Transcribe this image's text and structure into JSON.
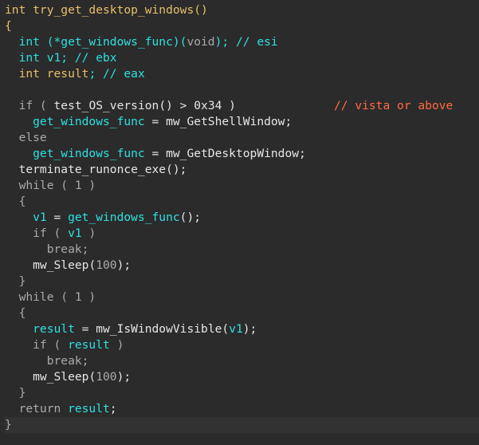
{
  "code_lines": [
    [
      {
        "t": "int try_get_desktop_windows()",
        "c": "t-name"
      }
    ],
    [
      {
        "t": "{",
        "c": "t-name"
      }
    ],
    [
      {
        "t": "  int ",
        "c": "t-cyan"
      },
      {
        "t": "(*get_windows_func)(",
        "c": "t-cyan"
      },
      {
        "t": "void",
        "c": "t-dim"
      },
      {
        "t": "); // esi",
        "c": "t-cyan"
      }
    ],
    [
      {
        "t": "  int ",
        "c": "t-cyan"
      },
      {
        "t": "v1",
        "c": "t-cyan"
      },
      {
        "t": "; // ebx",
        "c": "t-cyan"
      }
    ],
    [
      {
        "t": "  int ",
        "c": "t-name"
      },
      {
        "t": "result",
        "c": "t-name"
      },
      {
        "t": "; // eax",
        "c": "t-cyan"
      }
    ],
    [
      {
        "t": "",
        "c": "t-plain"
      }
    ],
    [
      {
        "t": "  if ( ",
        "c": "t-dim"
      },
      {
        "t": "test_OS_version",
        "c": "t-white"
      },
      {
        "t": "() > 0x34 )              ",
        "c": "t-white"
      },
      {
        "t": "// vista or above",
        "c": "t-cmt-red"
      }
    ],
    [
      {
        "t": "    get_windows_func",
        "c": "t-cyan"
      },
      {
        "t": " = ",
        "c": "t-white"
      },
      {
        "t": "mw_GetShellWindow",
        "c": "t-white"
      },
      {
        "t": ";",
        "c": "t-white"
      }
    ],
    [
      {
        "t": "  else",
        "c": "t-dim"
      }
    ],
    [
      {
        "t": "    get_windows_func",
        "c": "t-cyan"
      },
      {
        "t": " = ",
        "c": "t-white"
      },
      {
        "t": "mw_GetDesktopWindow",
        "c": "t-white"
      },
      {
        "t": ";",
        "c": "t-white"
      }
    ],
    [
      {
        "t": "  terminate_runonce_exe",
        "c": "t-white"
      },
      {
        "t": "();",
        "c": "t-white"
      }
    ],
    [
      {
        "t": "  while ( 1 )",
        "c": "t-dim"
      }
    ],
    [
      {
        "t": "  {",
        "c": "t-dim"
      }
    ],
    [
      {
        "t": "    v1",
        "c": "t-cyan"
      },
      {
        "t": " = ",
        "c": "t-white"
      },
      {
        "t": "get_windows_func",
        "c": "t-cyan"
      },
      {
        "t": "();",
        "c": "t-white"
      }
    ],
    [
      {
        "t": "    if ( ",
        "c": "t-dim"
      },
      {
        "t": "v1",
        "c": "t-cyan"
      },
      {
        "t": " )",
        "c": "t-dim"
      }
    ],
    [
      {
        "t": "      break;",
        "c": "t-dim"
      }
    ],
    [
      {
        "t": "    mw_Sleep",
        "c": "t-white"
      },
      {
        "t": "(",
        "c": "t-white"
      },
      {
        "t": "100",
        "c": "t-dim"
      },
      {
        "t": ");",
        "c": "t-white"
      }
    ],
    [
      {
        "t": "  }",
        "c": "t-dim"
      }
    ],
    [
      {
        "t": "  while ( 1 )",
        "c": "t-dim"
      }
    ],
    [
      {
        "t": "  {",
        "c": "t-dim"
      }
    ],
    [
      {
        "t": "    result",
        "c": "t-cyan"
      },
      {
        "t": " = ",
        "c": "t-white"
      },
      {
        "t": "mw_IsWindowVisible",
        "c": "t-white"
      },
      {
        "t": "(",
        "c": "t-white"
      },
      {
        "t": "v1",
        "c": "t-cyan"
      },
      {
        "t": ");",
        "c": "t-white"
      }
    ],
    [
      {
        "t": "    if ( ",
        "c": "t-dim"
      },
      {
        "t": "result",
        "c": "t-cyan"
      },
      {
        "t": " )",
        "c": "t-dim"
      }
    ],
    [
      {
        "t": "      break;",
        "c": "t-dim"
      }
    ],
    [
      {
        "t": "    mw_Sleep",
        "c": "t-white"
      },
      {
        "t": "(",
        "c": "t-white"
      },
      {
        "t": "100",
        "c": "t-dim"
      },
      {
        "t": ");",
        "c": "t-white"
      }
    ],
    [
      {
        "t": "  }",
        "c": "t-dim"
      }
    ],
    [
      {
        "t": "  return ",
        "c": "t-dim"
      },
      {
        "t": "result",
        "c": "t-cyan"
      },
      {
        "t": ";",
        "c": "t-white"
      }
    ],
    [
      {
        "t": "}",
        "c": "t-dim"
      }
    ]
  ],
  "current_line_index": 26,
  "colors": {
    "background": "#2b2b2b",
    "current_line": "#323232",
    "function_name": "#e8bf6a",
    "variable": "#2fe0e0",
    "keyword": "#aaaaaa",
    "comment_highlight": "#ff6a43"
  }
}
